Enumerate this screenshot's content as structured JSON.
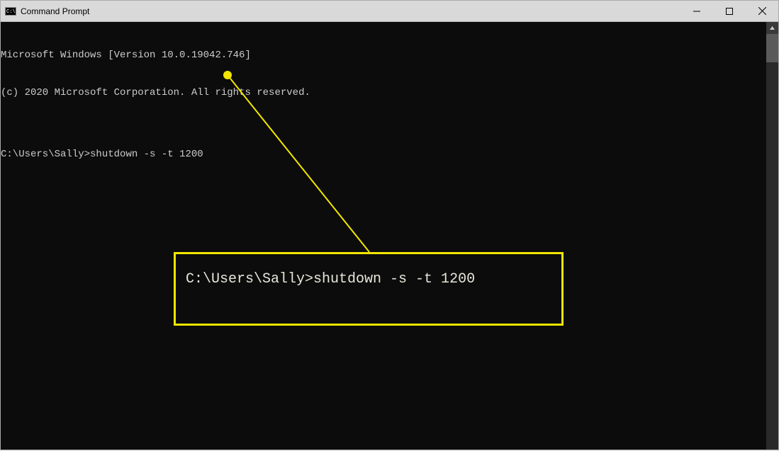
{
  "window": {
    "title": "Command Prompt"
  },
  "terminal": {
    "line1": "Microsoft Windows [Version 10.0.19042.746]",
    "line2": "(c) 2020 Microsoft Corporation. All rights reserved.",
    "blank": "",
    "prompt": "C:\\Users\\Sally>",
    "command": "shutdown -s -t 1200"
  },
  "annotation": {
    "callout_prompt": "C:\\Users\\Sally>",
    "callout_command": "shutdown -s -t 1200"
  }
}
